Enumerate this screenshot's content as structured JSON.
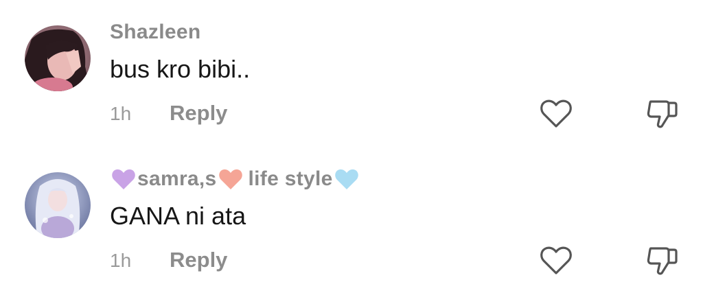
{
  "comments": [
    {
      "username": "Shazleen",
      "text": "bus kro bibi..",
      "time": "1h",
      "reply_label": "Reply",
      "like_icon": "heart-outline-icon",
      "dislike_icon": "thumbs-down-outline-icon"
    },
    {
      "username_parts": [
        "samra,s",
        "life style"
      ],
      "username_emoji": [
        "purple-heart",
        "salmon-heart",
        "light-blue-heart"
      ],
      "text": "GANA ni ata",
      "time": "1h",
      "reply_label": "Reply",
      "like_icon": "heart-outline-icon",
      "dislike_icon": "thumbs-down-outline-icon"
    }
  ],
  "colors": {
    "username": "#8a8a8a",
    "comment_text": "#161616",
    "meta": "#9a9a9a",
    "icon_stroke": "#555555",
    "heart_purple": "#c9a3e6",
    "heart_salmon": "#f5a596",
    "heart_blue": "#a9dcf3"
  }
}
